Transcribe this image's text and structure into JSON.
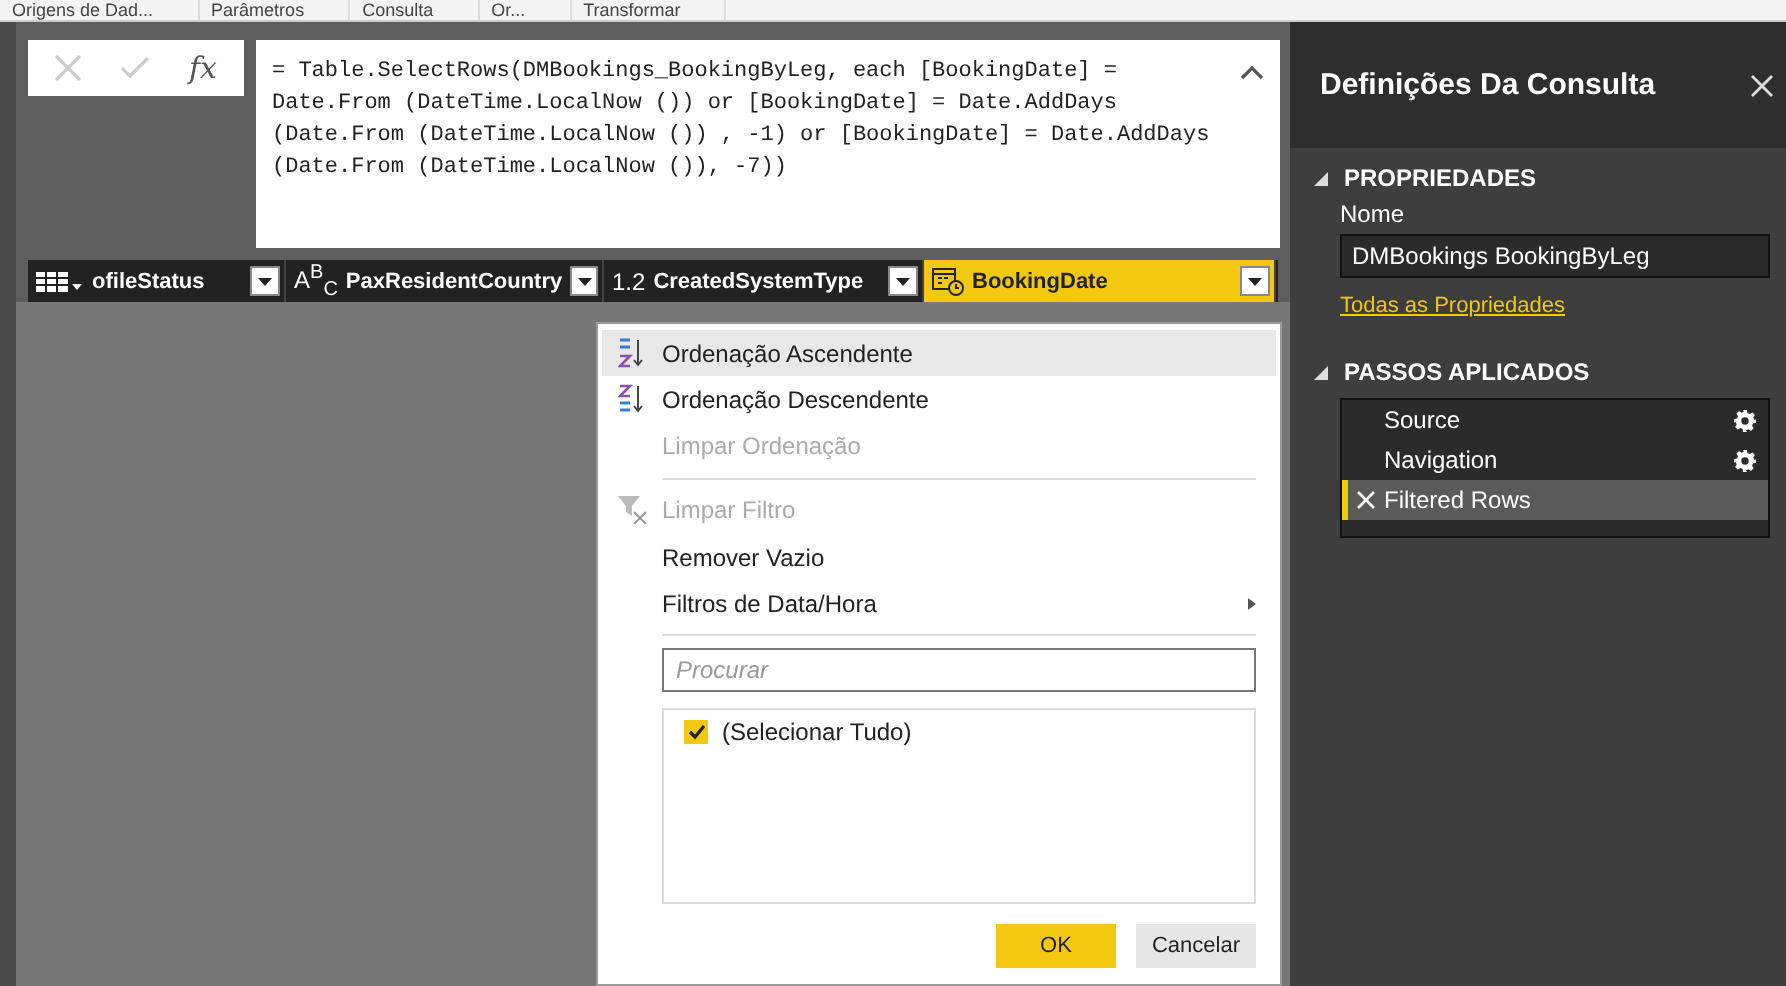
{
  "ribbon": {
    "tabs": [
      {
        "label": "Origens de Dad..."
      },
      {
        "label": "Parâmetros"
      },
      {
        "label": "Consulta"
      },
      {
        "label": "Or..."
      },
      {
        "label": "Transformar"
      }
    ]
  },
  "formula_bar": {
    "fx": "fx",
    "lines": [
      "= Table.SelectRows(DMBookings_BookingByLeg, each [BookingDate] =",
      "Date.From (DateTime.LocalNow ()) or [BookingDate] = Date.AddDays",
      "(Date.From (DateTime.LocalNow ()) , -1) or [BookingDate] = Date.AddDays",
      "(Date.From (DateTime.LocalNow ()), -7))"
    ]
  },
  "columns": [
    {
      "name": "ofileStatus",
      "kind": "table",
      "selected": false
    },
    {
      "name": "PaxResidentCountry",
      "kind": "text",
      "type_label": "A$^{B}$$_{C}$",
      "selected": false
    },
    {
      "name": "CreatedSystemType",
      "kind": "number",
      "type_label": "1.2",
      "selected": false
    },
    {
      "name": "BookingDate",
      "kind": "datetime",
      "selected": true
    }
  ],
  "filter_menu": {
    "items": [
      {
        "kind": "ascending",
        "label": "Ordenação Ascendente",
        "disabled": false,
        "highlighted": true,
        "submenu": false
      },
      {
        "kind": "descending",
        "label": "Ordenação Descendente",
        "disabled": false,
        "highlighted": false,
        "submenu": false
      },
      {
        "kind": "item",
        "label": "Limpar Ordenação",
        "disabled": true,
        "highlighted": false,
        "submenu": false
      },
      {
        "kind": "separator"
      },
      {
        "kind": "clearfilter",
        "label": "Limpar Filtro",
        "disabled": true,
        "highlighted": false,
        "submenu": false
      },
      {
        "kind": "item",
        "label": "Remover Vazio",
        "disabled": false,
        "highlighted": false,
        "submenu": false
      },
      {
        "kind": "item",
        "label": "Filtros de Data/Hora",
        "disabled": false,
        "highlighted": false,
        "submenu": true
      },
      {
        "kind": "separator"
      }
    ],
    "search": {
      "placeholder": "Procurar"
    },
    "values": [
      {
        "label": "(Selecionar Tudo)",
        "checked": true
      }
    ],
    "buttons": [
      {
        "label": "OK",
        "kind": "primary"
      },
      {
        "label": "Cancelar",
        "kind": "secondary"
      }
    ]
  },
  "query_settings": {
    "title": "Definições Da Consulta",
    "properties": {
      "title": "PROPRIEDADES",
      "expanded": true,
      "name_label": "Nome",
      "name_value": "DMBookings BookingByLeg",
      "link": "Todas as Propriedades"
    },
    "steps_section": {
      "title": "PASSOS APLICADOS",
      "expanded": true,
      "steps": [
        {
          "label": "Source",
          "selected": false,
          "has_settings": true
        },
        {
          "label": "Navigation",
          "selected": false,
          "has_settings": true
        },
        {
          "label": "Filtered Rows",
          "selected": true,
          "has_settings": false
        }
      ]
    }
  }
}
